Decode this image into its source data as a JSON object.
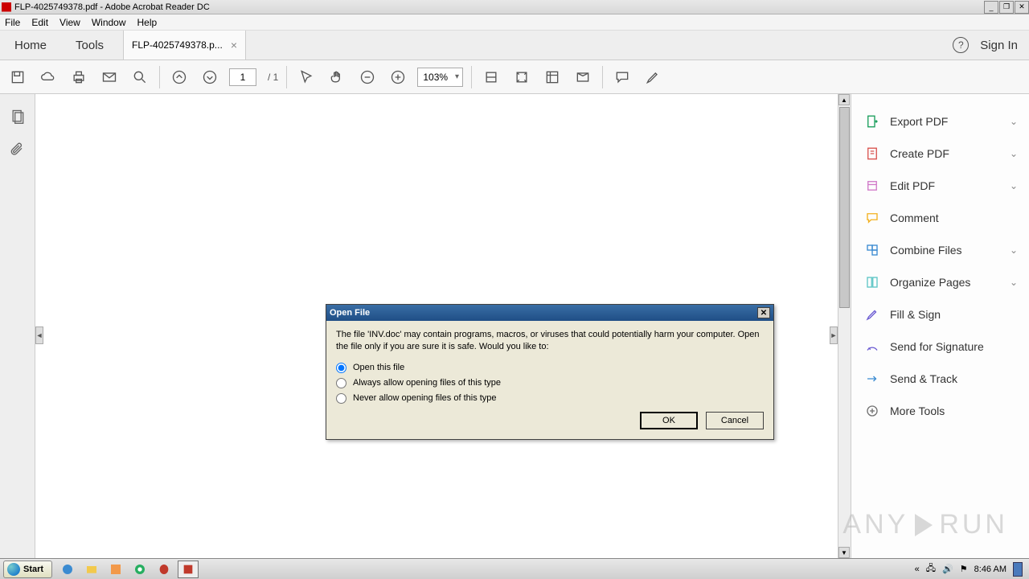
{
  "window": {
    "title": "FLP-4025749378.pdf - Adobe Acrobat Reader DC"
  },
  "menubar": [
    "File",
    "Edit",
    "View",
    "Window",
    "Help"
  ],
  "tabs": {
    "home": "Home",
    "tools": "Tools",
    "doc": "FLP-4025749378.p...",
    "signin": "Sign In"
  },
  "toolbar": {
    "page_current": "1",
    "page_total": "/  1",
    "zoom": "103%"
  },
  "rightpanel": {
    "items": [
      {
        "label": "Export PDF",
        "chev": true,
        "color": "#1a9e5c"
      },
      {
        "label": "Create PDF",
        "chev": true,
        "color": "#d9534f"
      },
      {
        "label": "Edit PDF",
        "chev": true,
        "color": "#d079c8"
      },
      {
        "label": "Comment",
        "chev": false,
        "color": "#f2b01e"
      },
      {
        "label": "Combine Files",
        "chev": true,
        "color": "#3b8bd1"
      },
      {
        "label": "Organize Pages",
        "chev": true,
        "color": "#5ec6c6"
      },
      {
        "label": "Fill & Sign",
        "chev": false,
        "color": "#6b5bd2"
      },
      {
        "label": "Send for Signature",
        "chev": false,
        "color": "#6b5bd2"
      },
      {
        "label": "Send & Track",
        "chev": false,
        "color": "#3b8bd1"
      },
      {
        "label": "More Tools",
        "chev": false,
        "color": "#707070"
      }
    ]
  },
  "dialog": {
    "title": "Open File",
    "message": "The file 'INV.doc' may contain programs, macros, or viruses that could potentially harm your computer. Open the file only if you are sure it is safe. Would you like to:",
    "opt1": "Open this file",
    "opt2": "Always allow opening files of this type",
    "opt3": "Never allow opening files of this type",
    "ok": "OK",
    "cancel": "Cancel"
  },
  "taskbar": {
    "start": "Start",
    "clock": "8:46 AM"
  },
  "watermark": {
    "a": "ANY",
    "b": "RUN"
  }
}
